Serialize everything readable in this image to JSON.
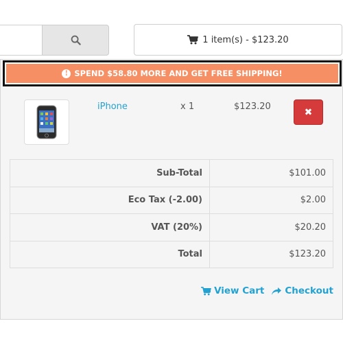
{
  "header": {
    "search_icon": "search-icon",
    "cart_icon": "shopping-cart-icon",
    "cart_summary": "1 item(s) - $123.20"
  },
  "shipping": {
    "icon": "exclamation-circle-icon",
    "message": "SPEND $58.80 MORE AND GET FREE SHIPPING!",
    "color": "#f68f63"
  },
  "cart_items": [
    {
      "name": "iPhone",
      "quantity": "x 1",
      "price": "$123.20",
      "remove_icon": "close-icon"
    }
  ],
  "totals": [
    {
      "label": "Sub-Total",
      "value": "$101.00"
    },
    {
      "label": "Eco Tax (-2.00)",
      "value": "$2.00"
    },
    {
      "label": "VAT (20%)",
      "value": "$20.20"
    },
    {
      "label": "Total",
      "value": "$123.20"
    }
  ],
  "links": {
    "view_cart": "View Cart",
    "checkout": "Checkout",
    "color": "#23a1d1"
  }
}
